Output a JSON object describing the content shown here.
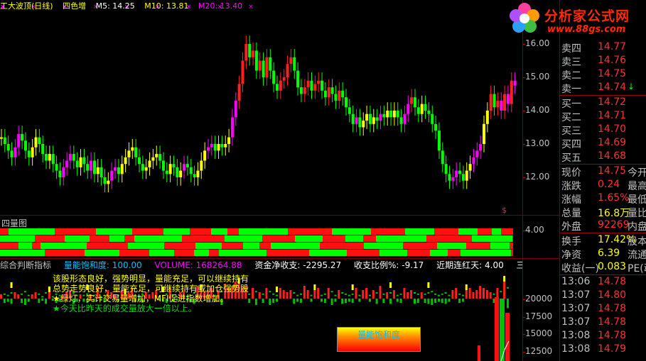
{
  "top_bar": {
    "stock": "工大波顶(日线)",
    "period": "四色增",
    "ma5": "M5: 14.25",
    "ma10": "M10: 13.81",
    "ma20": "M20: 13.40"
  },
  "price_axis": [
    "16.00",
    "15.00",
    "14.00",
    "13.00",
    "12.00"
  ],
  "volume_axis": [
    "20000",
    "17500",
    "15000",
    "12500"
  ],
  "sub1": {
    "title": "四量图",
    "axis": "4.00"
  },
  "indicator_bar": {
    "name": "综合判断指标",
    "saturation": "量能饱和度: 100.00",
    "volume": "VOLUME: 168264.88",
    "net_income": "资金净收支: -2295.27",
    "ratio": "收支比例%: -9.17",
    "consecutive": "近期连红天: 4.00",
    "three_day": "三日资金:"
  },
  "messages": [
    "该股形态良好，强势明显，量能充足，可以继续持有",
    "总势走势良好，量能充足，可继续持有或加仓强势股",
    "★绿灯，实计交易量增加，MFI促进指数增加。",
    "★今天比昨天的成交量放大一倍以上。"
  ],
  "vol_label": "量能饱和度",
  "logo": {
    "title": "分析家公式网",
    "url": "www.88gs.com"
  },
  "quotes": {
    "asks": [
      {
        "label": "卖四",
        "price": "14.77"
      },
      {
        "label": "卖三",
        "price": "14.76"
      },
      {
        "label": "卖二",
        "price": "14.75"
      },
      {
        "label": "卖一",
        "price": "14.74"
      }
    ],
    "bids": [
      {
        "label": "买一",
        "price": "14.72"
      },
      {
        "label": "买二",
        "price": "14.71"
      },
      {
        "label": "买三",
        "price": "14.70"
      },
      {
        "label": "买四",
        "price": "14.69"
      },
      {
        "label": "买五",
        "price": "14.68"
      }
    ],
    "stats": [
      {
        "label": "现价",
        "value": "14.75",
        "extra": "今开"
      },
      {
        "label": "涨跌",
        "value": "0.24",
        "extra": "最高"
      },
      {
        "label": "涨幅",
        "value": "1.65%",
        "extra": "最低"
      },
      {
        "label": "总量",
        "value": "16.8万",
        "extra": "量比"
      },
      {
        "label": "外盘",
        "value": "92269",
        "extra": "内盘"
      },
      {
        "label": "换手",
        "value": "17.42%",
        "extra": "股本"
      },
      {
        "label": "净资",
        "value": "6.39",
        "extra": "流通"
      },
      {
        "label": "收益(一)",
        "value": "0.083",
        "extra": "PE(动"
      }
    ],
    "ticks": [
      {
        "time": "13:06",
        "price": "14.78"
      },
      {
        "time": "13:07",
        "price": "14.80"
      },
      {
        "time": "13:07",
        "price": "14.78"
      },
      {
        "time": "13:07",
        "price": "14.78"
      },
      {
        "time": "13:08",
        "price": "14.78"
      },
      {
        "time": "13:08",
        "price": "14.79"
      },
      {
        "time": "13:09",
        "price": "14.78"
      }
    ]
  },
  "chart_data": {
    "type": "candlestick",
    "ylim": [
      11.2,
      16.4
    ],
    "closes": [
      13.2,
      13.0,
      12.8,
      12.6,
      12.9,
      13.3,
      13.1,
      12.8,
      12.6,
      12.9,
      13.2,
      13.0,
      12.7,
      12.5,
      12.7,
      12.4,
      12.2,
      12.0,
      12.3,
      12.5,
      12.7,
      12.5,
      12.3,
      12.6,
      12.4,
      12.2,
      12.5,
      12.1,
      12.3,
      12.0,
      11.8,
      11.9,
      12.2,
      12.3,
      12.1,
      12.4,
      12.6,
      12.8,
      12.9,
      12.6,
      12.4,
      12.2,
      12.3,
      12.5,
      12.6,
      12.7,
      12.5,
      12.2,
      12.1,
      12.4,
      12.3,
      12.0,
      12.2,
      12.4,
      12.3,
      12.1,
      12.0,
      12.2,
      12.5,
      12.8,
      12.9,
      13.0,
      12.8,
      13.0,
      12.9,
      13.0,
      13.2,
      13.8,
      14.3,
      14.8,
      15.5,
      16.0,
      15.6,
      15.8,
      15.2,
      15.5,
      15.0,
      15.6,
      15.2,
      14.8,
      14.6,
      14.9,
      15.0,
      15.4,
      15.6,
      15.2,
      14.7,
      14.5,
      14.7,
      14.9,
      14.6,
      14.8,
      14.9,
      14.6,
      14.4,
      14.7,
      14.5,
      14.3,
      14.6,
      14.4,
      14.1,
      13.9,
      13.6,
      13.8,
      13.5,
      13.7,
      13.9,
      13.6,
      13.8,
      13.7,
      13.9,
      13.8,
      14.0,
      13.8,
      14.0,
      13.8,
      13.6,
      13.9,
      14.2,
      14.4,
      14.1,
      13.9,
      14.2,
      14.0,
      13.9,
      13.6,
      13.4,
      12.8,
      12.4,
      12.1,
      11.9,
      12.0,
      12.2,
      12.1,
      11.9,
      12.2,
      12.4,
      12.6,
      12.8,
      13.0,
      13.6,
      14.0,
      14.5,
      14.1,
      14.3,
      14.0,
      14.5,
      14.2,
      14.9,
      14.75
    ],
    "volumes": [
      2,
      4,
      3,
      5,
      3,
      2,
      4,
      6,
      3,
      2,
      3,
      4,
      2,
      5,
      3,
      2,
      4,
      3,
      2,
      3,
      4,
      5,
      3,
      2,
      3,
      4,
      2,
      3,
      5,
      2,
      3,
      4,
      3,
      2,
      3,
      4,
      2,
      3,
      5,
      3,
      2,
      4,
      3,
      2,
      3,
      4,
      2,
      3,
      4,
      5,
      3,
      2,
      3,
      4,
      2,
      3,
      5,
      6,
      4,
      3,
      4,
      5,
      3,
      4,
      6,
      7,
      5,
      6,
      8,
      7,
      5,
      6,
      4,
      5,
      6,
      3,
      4,
      5,
      6,
      4,
      3,
      5,
      4,
      3,
      4,
      5,
      3,
      4,
      6,
      4,
      3,
      4,
      5,
      3,
      4,
      5,
      6,
      3,
      4,
      5,
      4,
      3,
      4,
      5,
      3,
      4,
      5,
      3,
      4,
      5,
      6,
      4,
      3,
      5,
      4,
      3,
      4,
      5,
      3,
      4,
      5,
      4,
      3,
      4,
      5,
      6,
      4,
      3,
      4,
      5,
      3,
      4,
      5,
      4,
      3,
      4,
      5,
      3,
      4,
      6,
      5,
      4,
      3,
      4,
      5,
      6,
      8,
      9
    ]
  }
}
